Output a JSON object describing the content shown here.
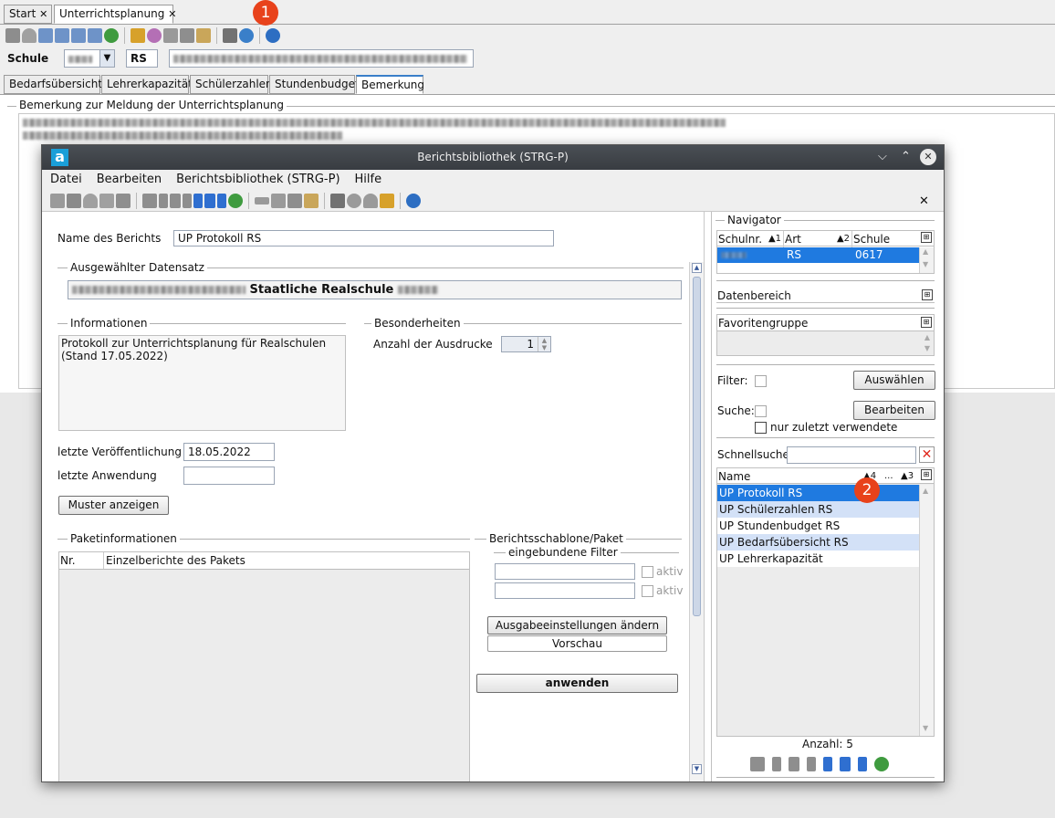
{
  "tabs": [
    {
      "label": "Start",
      "close": "✕"
    },
    {
      "label": "Unterrichtsplanung",
      "close": "✕"
    }
  ],
  "school": {
    "label": "Schule",
    "type_value": "RS"
  },
  "subtabs": [
    "Bedarfsübersicht",
    "Lehrerkapazität",
    "Schülerzahlen",
    "Stundenbudget",
    "Bemerkung"
  ],
  "remark_group": "Bemerkung zur Meldung der Unterrichtsplanung",
  "badges": [
    "1",
    "2"
  ],
  "dialog": {
    "title": "Berichtsbibliothek (STRG-P)",
    "logo": "a",
    "window_buttons": [
      "⌵",
      "⌃",
      "✕"
    ],
    "menu": [
      "Datei",
      "Bearbeiten",
      "Berichtsbibliothek (STRG-P)",
      "Hilfe"
    ],
    "close_x": "✕",
    "name_label": "Name des Berichts",
    "name_value": "UP Protokoll RS",
    "dataset_group": "Ausgewählter Datensatz",
    "dataset_value": "Staatliche Realschule",
    "info_group": "Informationen",
    "info_text": "Protokoll zur Unterrichtsplanung für Realschulen\n(Stand 17.05.2022)",
    "special_group": "Besonderheiten",
    "prints_label": "Anzahl der Ausdrucke",
    "prints_value": "1",
    "published_label": "letzte Veröffentlichung",
    "published_value": "18.05.2022",
    "used_label": "letzte Anwendung",
    "used_value": "",
    "sample_button": "Muster anzeigen",
    "package_group": "Paketinformationen",
    "package_cols": [
      "Nr.",
      "Einzelberichte des Pakets"
    ],
    "template_group": "Berichtsschablone/Paket",
    "filters_group": "eingebundene Filter",
    "active_label": "aktiv",
    "output_button": "Ausgabeeinstellungen ändern",
    "preview_button": "Vorschau",
    "apply_button": "anwenden"
  },
  "navigator": {
    "title": "Navigator",
    "cols": [
      "Schulnr.",
      "Art",
      "Schule"
    ],
    "sort_marks": [
      "▲1",
      "▲2"
    ],
    "row": {
      "art": "RS",
      "schule": "0617"
    },
    "data_range": "Datenbereich",
    "fav_group": "Favoritengruppe",
    "filter_label": "Filter:",
    "select_button": "Auswählen",
    "search_label": "Suche:",
    "edit_button": "Bearbeiten",
    "recent_label": "nur zuletzt verwendete",
    "quicksearch_label": "Schnellsuche",
    "list_cols": [
      "Name",
      "▲4",
      "...",
      "▲3"
    ],
    "reports": [
      "UP Protokoll RS",
      "UP Schülerzahlen RS",
      "UP Stundenbudget RS",
      "UP Bedarfsübersicht RS",
      "UP Lehrerkapazität"
    ],
    "count_label": "Anzahl: 5"
  }
}
